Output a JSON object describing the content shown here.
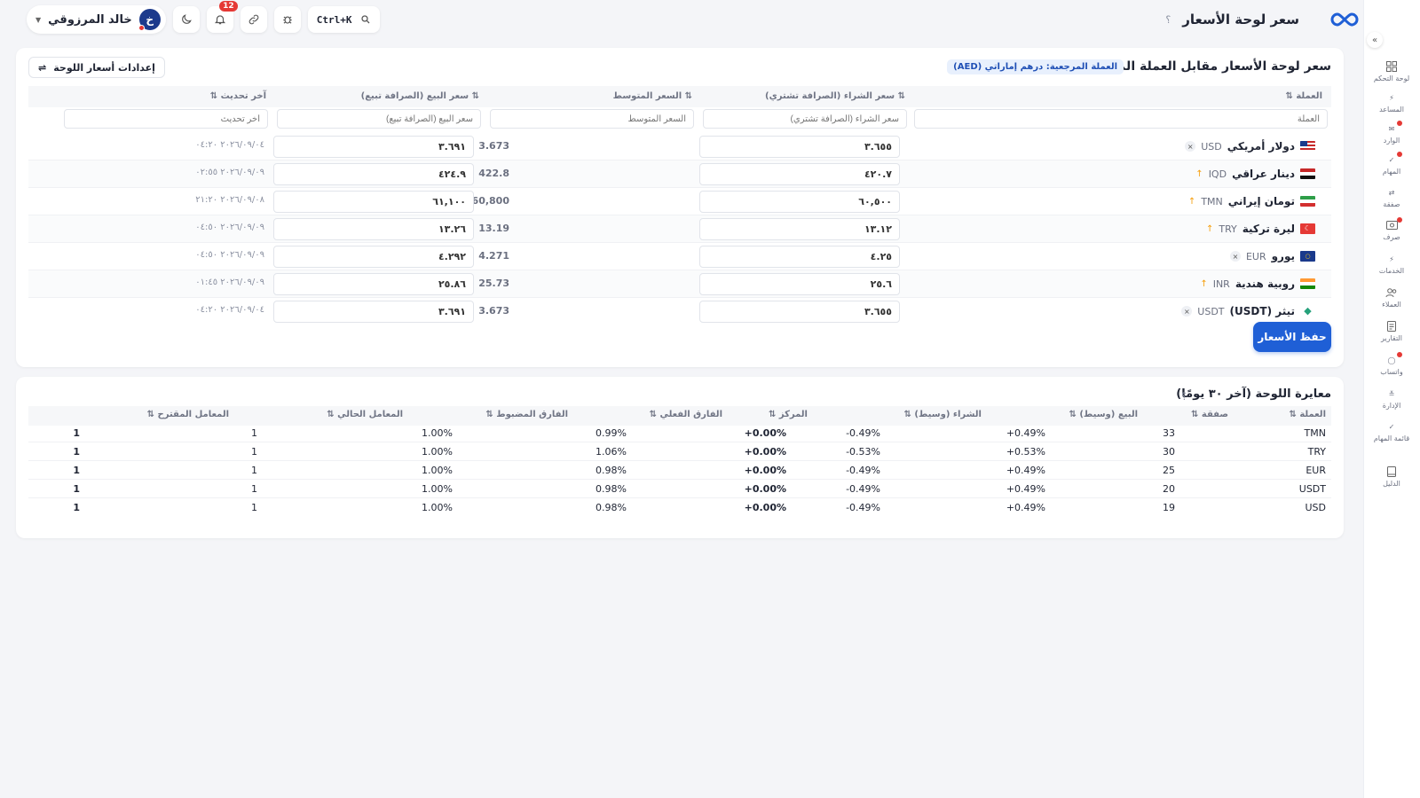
{
  "topbar": {
    "page_title": "سعر لوحة الأسعار",
    "help": "؟",
    "search_shortcut": "Ctrl+K",
    "notifications_count": "12",
    "user_name": "خالد المرزوقي",
    "avatar_initial": "خ"
  },
  "sidebar": {
    "items": [
      {
        "label": "لوحة التحكم",
        "icon": "dashboard-icon"
      },
      {
        "label": "المساعد",
        "icon": "bolt-icon"
      },
      {
        "label": "الوارد",
        "icon": "inbox-icon"
      },
      {
        "label": "المهام",
        "icon": "check-icon"
      },
      {
        "label": "صفقة",
        "icon": "swap-icon"
      },
      {
        "label": "صرف",
        "icon": "cash-icon"
      },
      {
        "label": "الخدمات",
        "icon": "bolt-icon"
      },
      {
        "label": "العملاء",
        "icon": "users-icon"
      },
      {
        "label": "التقارير",
        "icon": "report-icon"
      },
      {
        "label": "واتساب",
        "icon": "chat-icon"
      },
      {
        "label": "الإدارة",
        "icon": "sliders-icon"
      },
      {
        "label": "قائمة المهام",
        "icon": "check-icon"
      },
      {
        "label": "الدليل",
        "icon": "book-icon"
      }
    ]
  },
  "board": {
    "title": "سعر لوحة الأسعار مقابل العملة المرجعية",
    "reference_pill": "العملة المرجعية: درهم إماراتي (AED)",
    "settings_label": "إعدادات أسعار اللوحة",
    "headers": {
      "currency": "العملة ⇅",
      "buy": "⇅ سعر الشراء (الصرافة تشتري)",
      "avg": "⇅ السعر المتوسط",
      "sell": "⇅ سعر البيع (الصرافة تبيع)",
      "updated": "آخر تحديث ⇅"
    },
    "filters": {
      "currency": "العملة",
      "buy": "سعر الشراء (الصرافة تشتري)",
      "avg": "السعر المتوسط",
      "sell": "سعر البيع (الصرافة تبيع)",
      "updated": "آخر تحديث"
    },
    "rows": [
      {
        "name": "دولار أمريكي",
        "code": "USD",
        "mark": "×",
        "flag": "us",
        "buy": "٣.٦٥٥",
        "avg": "3.673",
        "sell": "٣.٦٩١",
        "updated": "٢٠٢٦/٠٩/٠٤ ٠٤:٢٠"
      },
      {
        "name": "دينار عراقي",
        "code": "IQD",
        "mark": "↑",
        "flag": "iq",
        "buy": "٤٢٠.٧",
        "avg": "422.8",
        "sell": "٤٢٤.٩",
        "updated": "٢٠٢٦/٠٩/٠٩ ٠٢:٥٥"
      },
      {
        "name": "تومان إيراني",
        "code": "TMN",
        "mark": "↑",
        "flag": "ir",
        "buy": "٦٠,٥٠٠",
        "avg": "60,800",
        "sell": "٦١,١٠٠",
        "updated": "٢٠٢٦/٠٩/٠٨ ٢١:٢٠"
      },
      {
        "name": "ليرة تركية",
        "code": "TRY",
        "mark": "↑",
        "flag": "tr",
        "buy": "١٣.١٢",
        "avg": "13.19",
        "sell": "١٣.٢٦",
        "updated": "٢٠٢٦/٠٩/٠٩ ٠٤:٥٠"
      },
      {
        "name": "يورو",
        "code": "EUR",
        "mark": "×",
        "flag": "eu",
        "buy": "٤.٢٥",
        "avg": "4.271",
        "sell": "٤.٢٩٢",
        "updated": "٢٠٢٦/٠٩/٠٩ ٠٤:٥٠"
      },
      {
        "name": "روبية هندية",
        "code": "INR",
        "mark": "↑",
        "flag": "in",
        "buy": "٢٥.٦",
        "avg": "25.73",
        "sell": "٢٥.٨٦",
        "updated": "٢٠٢٦/٠٩/٠٩ ٠١:٤٥"
      },
      {
        "name": "تيثر (USDT)",
        "code": "USDT",
        "mark": "×",
        "flag": "usdt",
        "buy": "٣.٦٥٥",
        "avg": "3.673",
        "sell": "٣.٦٩١",
        "updated": "٢٠٢٦/٠٩/٠٤ ٠٤:٢٠"
      }
    ],
    "save_label": "حفظ الأسعار"
  },
  "benchmark": {
    "title": "معايرة اللوحة (آخر ٣٠ يومًا)",
    "help": "؟",
    "headers": [
      "العملة ⇅",
      "صفقة ⇅",
      "البيع (وسيط) ⇅",
      "الشراء (وسيط) ⇅",
      "المركز ⇅",
      "الفارق الفعلي ⇅",
      "الفارق المضبوط ⇅",
      "المعامل الحالي ⇅",
      "المعامل المقترح ⇅"
    ],
    "rows": [
      {
        "currency": "TMN",
        "deals": "33",
        "sell": "+0.49%",
        "buy": "-0.49%",
        "center": "+0.00%",
        "actual": "0.99%",
        "set": "1.00%",
        "current": "1",
        "suggested": "1"
      },
      {
        "currency": "TRY",
        "deals": "30",
        "sell": "+0.53%",
        "buy": "-0.53%",
        "center": "+0.00%",
        "actual": "1.06%",
        "set": "1.00%",
        "current": "1",
        "suggested": "1"
      },
      {
        "currency": "EUR",
        "deals": "25",
        "sell": "+0.49%",
        "buy": "-0.49%",
        "center": "+0.00%",
        "actual": "0.98%",
        "set": "1.00%",
        "current": "1",
        "suggested": "1"
      },
      {
        "currency": "USDT",
        "deals": "20",
        "sell": "+0.49%",
        "buy": "-0.49%",
        "center": "+0.00%",
        "actual": "0.98%",
        "set": "1.00%",
        "current": "1",
        "suggested": "1"
      },
      {
        "currency": "USD",
        "deals": "19",
        "sell": "+0.49%",
        "buy": "-0.49%",
        "center": "+0.00%",
        "actual": "0.98%",
        "set": "1.00%",
        "current": "1",
        "suggested": "1"
      }
    ]
  },
  "colors": {
    "accent": "#1f5fd6",
    "danger": "#e53935",
    "warning": "#f59e0b"
  }
}
